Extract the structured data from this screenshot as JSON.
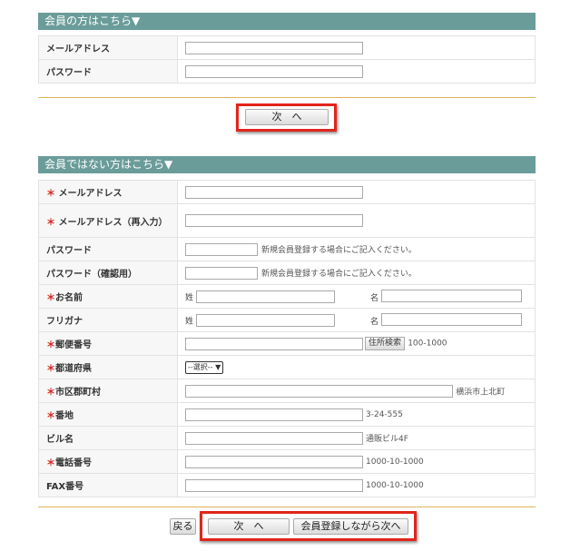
{
  "member": {
    "header": "会員の方はこちら▼",
    "fields": [
      {
        "label": "メールアドレス"
      },
      {
        "label": "パスワード"
      }
    ],
    "next_label": "次　へ"
  },
  "nonmember": {
    "header": "会員ではない方はこちら▼",
    "required_mark": "＊",
    "email_label": "メールアドレス",
    "email_confirm_label": "メールアドレス（再入力）",
    "password_label": "パスワード",
    "password_note": "新規会員登録する場合にご記入ください。",
    "password_confirm_label": "パスワード（確認用）",
    "password_confirm_note": "新規会員登録する場合にご記入ください。",
    "name_label": "お名前",
    "sei": "姓",
    "mei": "名",
    "kana_label": "フリガナ",
    "kana_sei": "姓",
    "kana_mei": "名",
    "postal_label": "郵便番号",
    "postal_button": "住所検索",
    "postal_hint": "100-1000",
    "pref_label": "都道府県",
    "pref_select": "--選択--",
    "city_label": "市区郡町村",
    "city_hint": "横浜市上北町",
    "address_label": "番地",
    "address_hint": "3-24-555",
    "building_label": "ビル名",
    "building_hint": "通販ビル4F",
    "tel_label": "電話番号",
    "tel_hint": "1000-10-1000",
    "fax_label": "FAX番号",
    "fax_hint": "1000-10-1000"
  },
  "footer": {
    "back_label": "戻る",
    "next_label": "次　へ",
    "register_next_label": "会員登録しながら次へ"
  },
  "colors": {
    "header_bg": "#6a9c9a",
    "required": "#d8231d",
    "highlight": "#e1251b",
    "separator": "#e0b45a"
  }
}
